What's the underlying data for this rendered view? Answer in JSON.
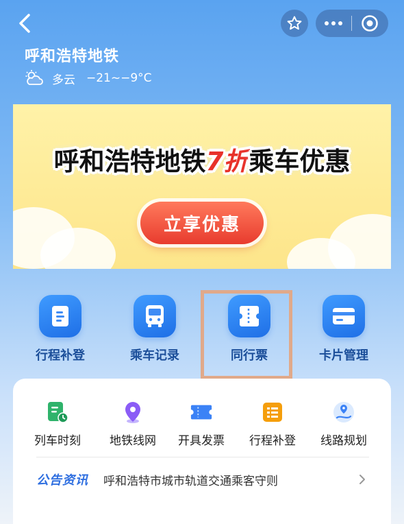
{
  "header": {
    "title": "呼和浩特地铁",
    "weather": {
      "condition": "多云",
      "temperature": "−21~−9°C",
      "icon": "cloudy-sun-icon"
    }
  },
  "nav_icons": {
    "back": "chevron-left-icon",
    "favorite": "star-icon",
    "more": "more-dots-icon",
    "close": "target-icon"
  },
  "banner": {
    "headline_before": "呼和浩特地铁",
    "headline_discount": "7折",
    "headline_after": "乘车优惠",
    "cta_label": "立享优惠"
  },
  "quick_actions": [
    {
      "label": "行程补登",
      "icon": "document-icon"
    },
    {
      "label": "乘车记录",
      "icon": "bus-icon"
    },
    {
      "label": "同行票",
      "icon": "ticket-icon",
      "highlighted": true
    },
    {
      "label": "卡片管理",
      "icon": "card-icon"
    }
  ],
  "services": [
    {
      "label": "列车时刻",
      "icon": "schedule-clock-icon",
      "color": "#2fb36b"
    },
    {
      "label": "地铁线网",
      "icon": "map-pin-icon",
      "color": "#8b5cf6"
    },
    {
      "label": "开具发票",
      "icon": "invoice-ticket-icon",
      "color": "#3b82f6"
    },
    {
      "label": "行程补登",
      "icon": "list-icon",
      "color": "#f59e0b"
    },
    {
      "label": "线路规划",
      "icon": "route-icon",
      "color": "#60a5fa"
    }
  ],
  "notice": {
    "tag": "公告资讯",
    "text": "呼和浩特市城市轨道交通乘客守则"
  },
  "colors": {
    "accent_blue": "#1f6fe6",
    "discount_red": "#e8322a",
    "highlight_border": "#e0a98a"
  }
}
